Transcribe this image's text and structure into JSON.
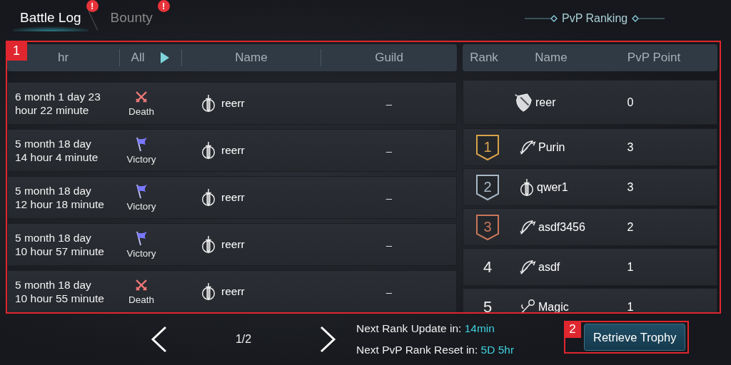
{
  "tabs": [
    {
      "label": "Battle Log",
      "selected": true,
      "alert": "!"
    },
    {
      "label": "Bounty",
      "selected": false,
      "alert": "!"
    }
  ],
  "ranking_title": "PvP Ranking",
  "annotations": [
    "1",
    "2"
  ],
  "battle_log": {
    "columns": [
      "hr",
      "All",
      "Name",
      "Guild"
    ],
    "rows": [
      {
        "time": [
          "6 month 1 day 23",
          "hour 22 minute"
        ],
        "result": {
          "kind": "death",
          "label": "Death"
        },
        "kind": "sword",
        "name": "reerr",
        "guild": "–"
      },
      {
        "time": [
          "5 month 18 day",
          "14 hour 4 minute"
        ],
        "result": {
          "kind": "victory",
          "label": "Victory"
        },
        "kind": "sword",
        "name": "reerr",
        "guild": "–"
      },
      {
        "time": [
          "5 month 18 day",
          "12 hour 18 minute"
        ],
        "result": {
          "kind": "victory",
          "label": "Victory"
        },
        "kind": "sword",
        "name": "reerr",
        "guild": "–"
      },
      {
        "time": [
          "5 month 18 day",
          "10 hour 57 minute"
        ],
        "result": {
          "kind": "victory",
          "label": "Victory"
        },
        "kind": "sword",
        "name": "reerr",
        "guild": "–"
      },
      {
        "time": [
          "5 month 18 day",
          "10 hour 55 minute"
        ],
        "result": {
          "kind": "death",
          "label": "Death"
        },
        "kind": "sword",
        "name": "reerr",
        "guild": "–"
      }
    ]
  },
  "ranking": {
    "columns": [
      "Rank",
      "Name",
      "PvP Point"
    ],
    "my_row": {
      "kind": "shield",
      "name": "reer",
      "points": "0"
    },
    "rows": [
      {
        "rank": "1",
        "color": "#d9a24a",
        "kind": "bow",
        "name": "Purin",
        "points": "3"
      },
      {
        "rank": "2",
        "color": "#a9b8c6",
        "kind": "sword",
        "name": "qwer1",
        "points": "3"
      },
      {
        "rank": "3",
        "color": "#c8775a",
        "kind": "bow",
        "name": "asdf3456",
        "points": "2"
      },
      {
        "rank": "4",
        "kind": "bow",
        "name": "asdf",
        "points": "1"
      },
      {
        "rank": "5",
        "kind": "staff",
        "name": "Magic",
        "points": "1"
      }
    ]
  },
  "footer": {
    "page": "1/2",
    "rank_update": {
      "label": "Next Rank Update in:",
      "value": "14min"
    },
    "rank_reset": {
      "label": "Next PvP Rank Reset in:",
      "value": "5D 5hr"
    },
    "button": "Retrieve Trophy"
  }
}
